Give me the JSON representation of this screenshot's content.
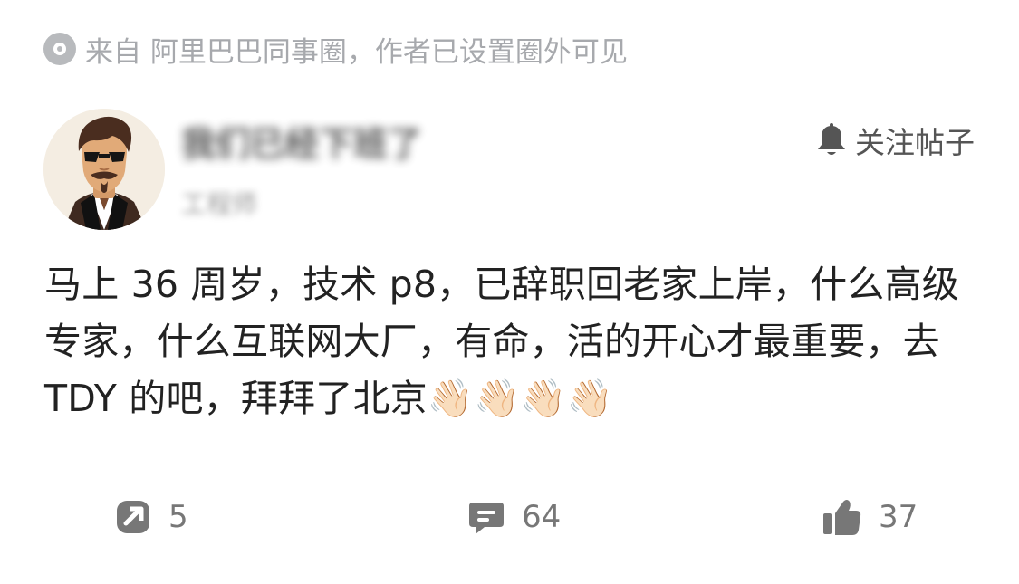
{
  "source": {
    "text": "来自 阿里巴巴同事圈，作者已设置圈外可见"
  },
  "author": {
    "name": "我们已经下班了",
    "meta": "工程师",
    "follow_label": "关注帖子"
  },
  "post": {
    "content": "马上 36 周岁，技术 p8，已辞职回老家上岸，什么高级专家，什么互联网大厂，有命，活的开心才最重要，去 TDY 的吧，拜拜了北京👋🏻👋🏻👋🏻👋🏻"
  },
  "actions": {
    "share_count": "5",
    "comment_count": "64",
    "like_count": "37"
  },
  "icons": {
    "source": "circle-source-icon",
    "follow": "bell-icon",
    "share": "share-icon",
    "comment": "comment-icon",
    "like": "thumbs-up-icon"
  },
  "colors": {
    "text": "#222222",
    "muted": "#a7a9ad",
    "action": "#777777",
    "background": "#ffffff"
  }
}
